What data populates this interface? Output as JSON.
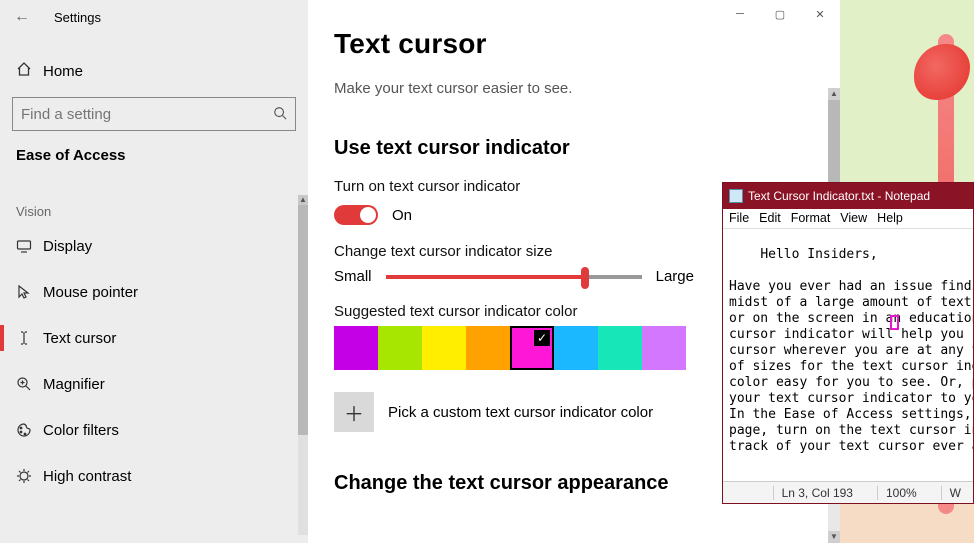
{
  "app_title": "Settings",
  "sidebar": {
    "home": "Home",
    "search_placeholder": "Find a setting",
    "category": "Ease of Access",
    "group": "Vision",
    "items": [
      {
        "label": "Display"
      },
      {
        "label": "Mouse pointer"
      },
      {
        "label": "Text cursor"
      },
      {
        "label": "Magnifier"
      },
      {
        "label": "Color filters"
      },
      {
        "label": "High contrast"
      }
    ]
  },
  "page": {
    "title": "Text cursor",
    "subtitle": "Make your text cursor easier to see.",
    "section1": "Use text cursor indicator",
    "toggle_label": "Turn on text cursor indicator",
    "toggle_state": "On",
    "size_label": "Change text cursor indicator size",
    "size_small": "Small",
    "size_large": "Large",
    "slider_pct": 78,
    "color_label": "Suggested text cursor indicator color",
    "swatches": [
      "#c400e6",
      "#a6e600",
      "#ffee00",
      "#ffa200",
      "#ff17d8",
      "#1bb8ff",
      "#17e6b9",
      "#d477ff"
    ],
    "selected_swatch": 4,
    "custom_label": "Pick a custom text cursor indicator color",
    "section2_cut": "Change the text cursor appearance"
  },
  "notepad": {
    "title": "Text Cursor Indicator.txt - Notepad",
    "menu": [
      "File",
      "Edit",
      "Format",
      "View",
      "Help"
    ],
    "lines": [
      "Hello Insiders,",
      "",
      "Have you ever had an issue findi",
      "midst of a large amount of text,",
      "or on the screen in an education",
      "cursor indicator will help you s",
      "cursor wherever you are at any t",
      "of sizes for the text cursor ind",
      "color easy for you to see. Or, p",
      "your text cursor indicator to yo",
      "In the Ease of Access settings, ",
      "page, turn on the text cursor in",
      "track of your text cursor ever a"
    ],
    "status_pos": "Ln 3, Col 193",
    "status_zoom": "100%",
    "status_rest": "W"
  }
}
